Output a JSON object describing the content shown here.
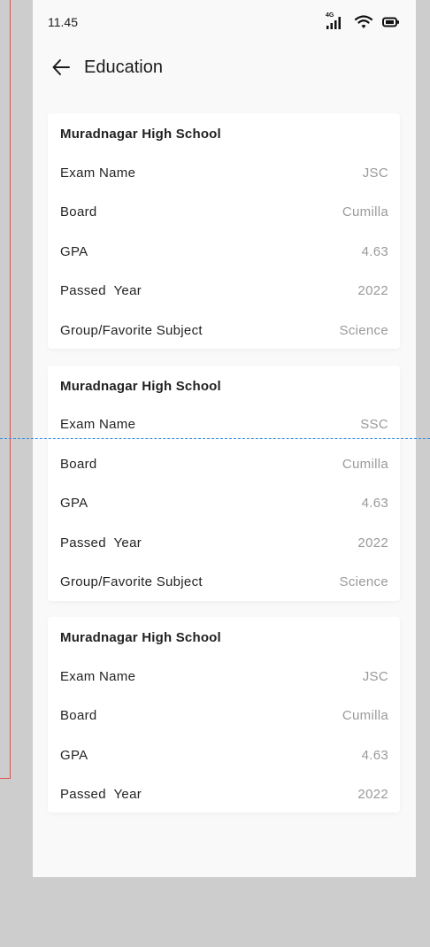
{
  "status_bar": {
    "time": "11.45",
    "network_label": "4G"
  },
  "header": {
    "title": "Education"
  },
  "cards": [
    {
      "school": "Muradnagar High School",
      "rows": [
        {
          "label": "Exam Name",
          "value": "JSC"
        },
        {
          "label": "Board",
          "value": "Cumilla"
        },
        {
          "label": "GPA",
          "value": "4.63"
        },
        {
          "label": "Passed  Year",
          "value": "2022"
        },
        {
          "label": "Group/Favorite Subject",
          "value": "Science"
        }
      ]
    },
    {
      "school": "Muradnagar High School",
      "rows": [
        {
          "label": "Exam Name",
          "value": "SSC"
        },
        {
          "label": "Board",
          "value": "Cumilla"
        },
        {
          "label": "GPA",
          "value": "4.63"
        },
        {
          "label": "Passed  Year",
          "value": "2022"
        },
        {
          "label": "Group/Favorite Subject",
          "value": "Science"
        }
      ]
    },
    {
      "school": "Muradnagar High School",
      "rows": [
        {
          "label": "Exam Name",
          "value": "JSC"
        },
        {
          "label": "Board",
          "value": "Cumilla"
        },
        {
          "label": "GPA",
          "value": "4.63"
        },
        {
          "label": "Passed  Year",
          "value": "2022"
        }
      ]
    }
  ]
}
